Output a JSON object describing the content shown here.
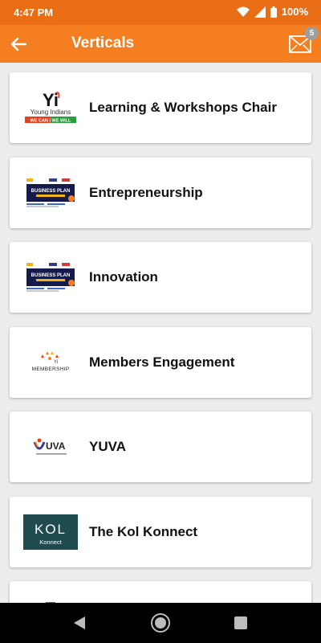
{
  "status_bar": {
    "time": "4:47 PM",
    "battery": "100%",
    "icons": [
      "wifi-icon",
      "signal-icon",
      "battery-icon"
    ]
  },
  "header": {
    "title": "Verticals",
    "back_icon": "back-arrow-icon",
    "mail_icon": "mail-icon",
    "notification_count": "5"
  },
  "verticals": [
    {
      "label": "Learning & Workshops Chair",
      "logo": "young-indians-logo",
      "logo_text": "Yi",
      "logo_sub": "Young Indians",
      "logo_tag": "WE CAN | WE WILL"
    },
    {
      "label": "Entrepreneurship",
      "logo": "business-plan-competition-banner",
      "logo_text": "BUSINESS PLAN"
    },
    {
      "label": "Innovation",
      "logo": "business-plan-competition-banner",
      "logo_text": "BUSINESS PLAN"
    },
    {
      "label": "Members Engagement",
      "logo": "yi-membership-logo",
      "logo_text": "MEMBERSHIP"
    },
    {
      "label": "YUVA",
      "logo": "yuva-logo",
      "logo_text": "UVA"
    },
    {
      "label": "The Kol Konnect",
      "logo": "kol-konnect-logo",
      "logo_text": "KOL",
      "logo_sub": "Konnect"
    }
  ],
  "nav_bar": {
    "icons": [
      "nav-back-icon",
      "nav-home-icon",
      "nav-recents-icon"
    ]
  },
  "colors": {
    "status_bar": "#e96d14",
    "app_bar": "#f57f20",
    "background": "#ededed",
    "badge": "#9e9e9e",
    "kol_logo": "#1f4a4f"
  }
}
